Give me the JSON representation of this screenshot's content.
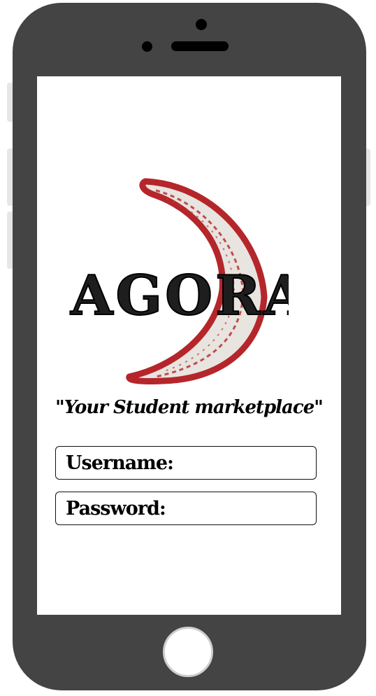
{
  "logo": {
    "text": "AGORA",
    "colors": {
      "crescent": "#b5262b",
      "crescent_fill": "#e8e4df",
      "text": "#1e1e1e"
    }
  },
  "tagline": "\"Your Student marketplace\"",
  "login": {
    "username_label": "Username:",
    "password_label": "Password:"
  },
  "device": {
    "frame_color": "#444444",
    "screen_color": "#ffffff"
  }
}
